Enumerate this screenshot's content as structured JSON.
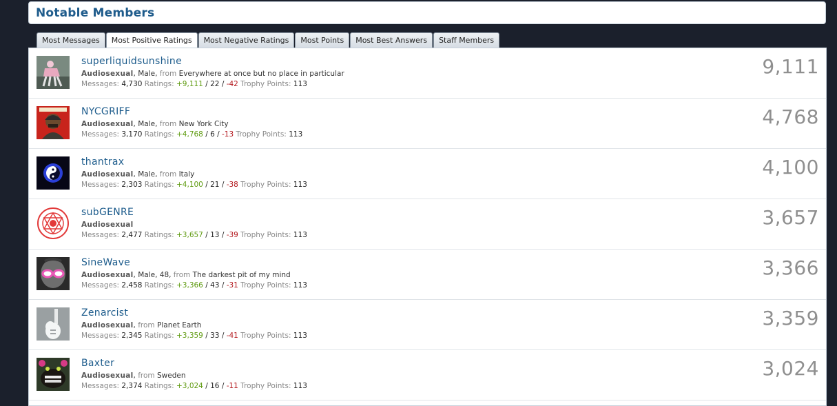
{
  "header": {
    "title": "Notable Members"
  },
  "tabs": [
    {
      "label": "Most Messages"
    },
    {
      "label": "Most Positive Ratings"
    },
    {
      "label": "Most Negative Ratings"
    },
    {
      "label": "Most Points"
    },
    {
      "label": "Most Best Answers"
    },
    {
      "label": "Staff Members"
    }
  ],
  "active_tab": 1,
  "labels": {
    "from": "from",
    "messages": "Messages:",
    "ratings": "Ratings:",
    "trophy_points": "Trophy Points:",
    "sep": "/"
  },
  "members": [
    {
      "name": "superliquidsunshine",
      "title": "Audiosexual",
      "details": ", Male,",
      "from": "Everywhere at once but no place in particular",
      "messages": "4,730",
      "pos": "+9,111",
      "neu": "22",
      "neg": "-42",
      "trophy": "113",
      "count": "9,111",
      "avatar": "mannequin"
    },
    {
      "name": "NYCGRIFF",
      "title": "Audiosexual",
      "details": ", Male,",
      "from": "New York City",
      "messages": "3,170",
      "pos": "+4,768",
      "neu": "6",
      "neg": "-13",
      "trophy": "113",
      "count": "4,768",
      "avatar": "magazine-portrait"
    },
    {
      "name": "thantrax",
      "title": "Audiosexual",
      "details": ", Male,",
      "from": "Italy",
      "messages": "2,303",
      "pos": "+4,100",
      "neu": "21",
      "neg": "-38",
      "trophy": "113",
      "count": "4,100",
      "avatar": "yin-yang"
    },
    {
      "name": "subGENRE",
      "title": "Audiosexual",
      "details": "",
      "from": "",
      "messages": "2,477",
      "pos": "+3,657",
      "neu": "13",
      "neg": "-39",
      "trophy": "113",
      "count": "3,657",
      "avatar": "red-seal"
    },
    {
      "name": "SineWave",
      "title": "Audiosexual",
      "details": ", Male, 48,",
      "from": "The darkest pit of my mind",
      "messages": "2,458",
      "pos": "+3,366",
      "neu": "43",
      "neg": "-31",
      "trophy": "113",
      "count": "3,366",
      "avatar": "masked-face"
    },
    {
      "name": "Zenarcist",
      "title": "Audiosexual",
      "details": ",",
      "from": "Planet Earth",
      "messages": "2,345",
      "pos": "+3,359",
      "neu": "33",
      "neg": "-41",
      "trophy": "113",
      "count": "3,359",
      "avatar": "guitar"
    },
    {
      "name": "Baxter",
      "title": "Audiosexual",
      "details": ",",
      "from": "Sweden",
      "messages": "2,374",
      "pos": "+3,024",
      "neu": "16",
      "neg": "-11",
      "trophy": "113",
      "count": "3,024",
      "avatar": "monster"
    }
  ],
  "colors": {
    "background": "#1b202c",
    "link": "#1d5c8c",
    "positive": "#5e9a0f",
    "negative": "#b3171d",
    "count": "#8f8f8f"
  }
}
